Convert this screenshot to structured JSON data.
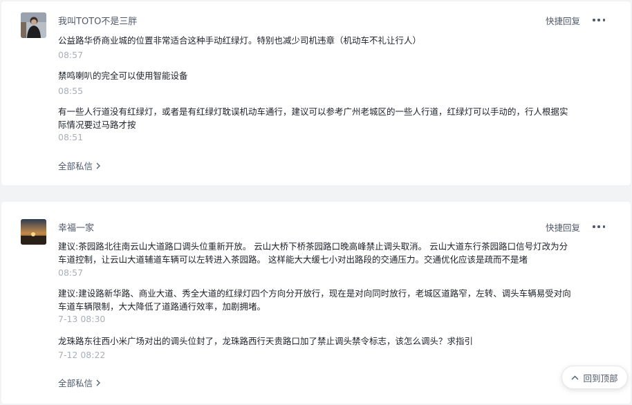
{
  "conversations": [
    {
      "username": "我叫TOTO不是三胖",
      "reply_label": "快捷回复",
      "more_icon": "more-dots-icon",
      "messages": [
        {
          "text": "公益路华侨商业城的位置非常适合这种手动红绿灯。特别也减少司机违章（机动车不礼让行人）",
          "time": "08:57"
        },
        {
          "text": "禁鸣喇叭的完全可以使用智能设备",
          "time": "08:55"
        },
        {
          "text": "有一些人行道没有红绿灯，或者是有红绿灯耽误机动车通行，建议可以参考广州老城区的一些人行道，红绿灯可以手动的，行人根据实际情况要过马路才按",
          "time": "08:51"
        }
      ],
      "all_messages_label": "全部私信"
    },
    {
      "username": "幸福一家",
      "reply_label": "快捷回复",
      "more_icon": "more-dots-icon",
      "messages": [
        {
          "text": "建议:茶园路北往南云山大道路口调头位重新开放。 云山大桥下桥茶园路口晚高峰禁止调头取消。 云山大道东行茶园路口信号灯改为分车道控制，让云山大道辅道车辆可以左转进入茶园路。 这样能大大缓七小对出路段的交通压力。交通优化应该是疏而不是堵",
          "time": "08:57"
        },
        {
          "text": "建议:建设路新华路、商业大道、秀全大道的红绿灯四个方向分开放行，现在是对向同时放行，老城区道路窄，左转、调头车辆易受对向车道车辆限制，大大降低了道路通行效率，加剧拥堵。",
          "time": "7-13 08:30"
        },
        {
          "text": "龙珠路东往西小米广场对出的调头位封了，龙珠路西行天贵路口加了禁止调头禁令标志，该怎么调头？求指引",
          "time": "7-12 08:22"
        }
      ],
      "all_messages_label": "全部私信"
    }
  ],
  "back_to_top_label": "回到顶部",
  "colors": {
    "page_bg": "#f2f3f5",
    "card_bg": "#ffffff",
    "text_primary": "#1d2129",
    "text_secondary": "#4e5969",
    "text_time": "#a9aeb8"
  }
}
